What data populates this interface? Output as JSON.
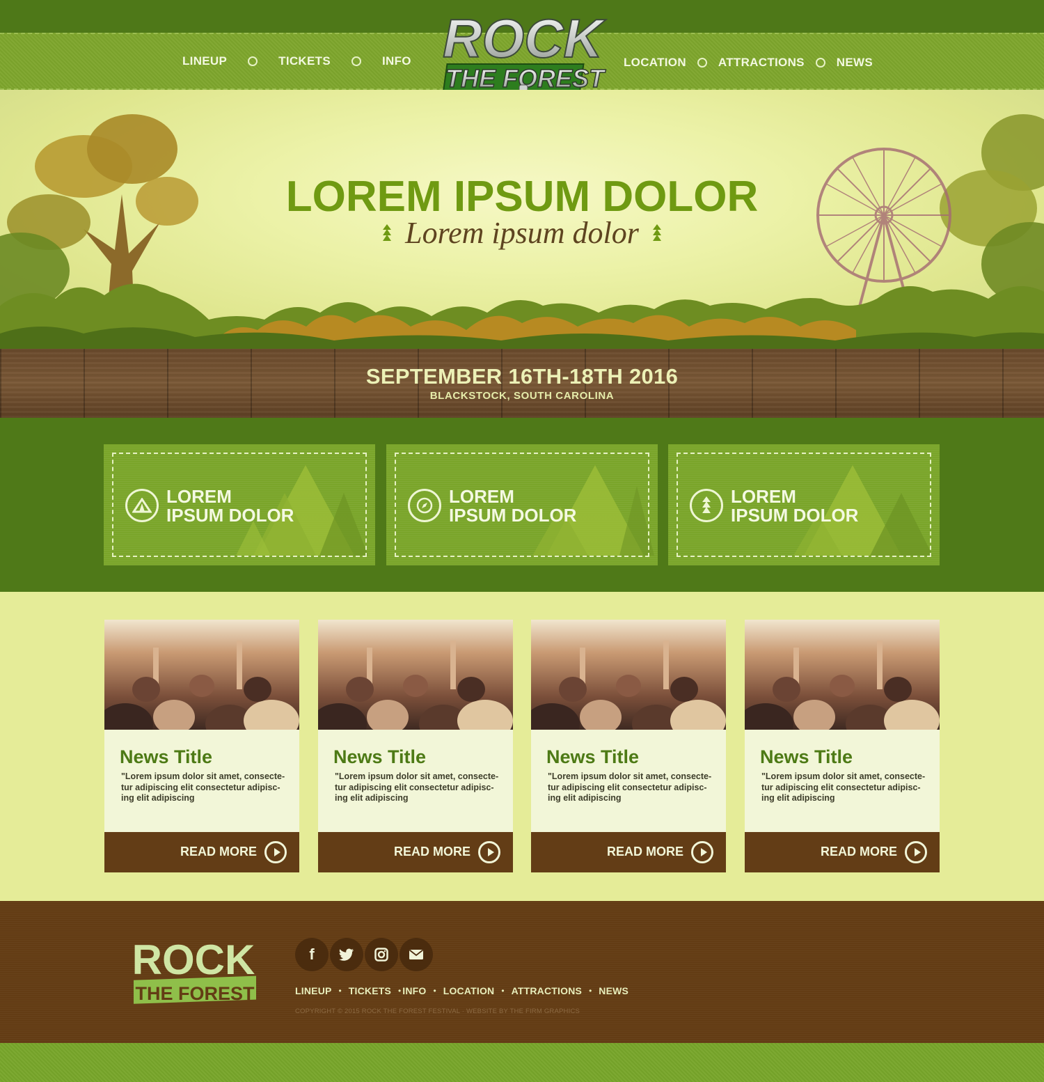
{
  "nav": {
    "left": [
      "LINEUP",
      "TICKETS",
      "INFO"
    ],
    "right": [
      "LOCATION",
      "ATTRACTIONS",
      "NEWS"
    ]
  },
  "logo": {
    "line1": "ROCK",
    "line2": "THE FOREST"
  },
  "hero": {
    "title": "LOREM IPSUM DOLOR",
    "subtitle": "Lorem ipsum dolor"
  },
  "event": {
    "date": "SEPTEMBER 16TH-18TH 2016",
    "location": "BLACKSTOCK, SOUTH CAROLINA"
  },
  "features": [
    {
      "icon": "tent-icon",
      "line1": "LOREM",
      "line2": "IPSUM DOLOR"
    },
    {
      "icon": "compass-icon",
      "line1": "LOREM",
      "line2": "IPSUM DOLOR"
    },
    {
      "icon": "pine-tree-icon",
      "line1": "LOREM",
      "line2": "IPSUM DOLOR"
    }
  ],
  "news": [
    {
      "title": "News Title",
      "text": "\"Lorem ipsum dolor sit amet, consecte-tur adipiscing elit consectetur adipisc-ing elit adipiscing",
      "button": "READ MORE"
    },
    {
      "title": "News Title",
      "text": "\"Lorem ipsum dolor sit amet, consecte-tur adipiscing elit consectetur adipisc-ing elit adipiscing",
      "button": "READ MORE"
    },
    {
      "title": "News Title",
      "text": "\"Lorem ipsum dolor sit amet, consecte-tur adipiscing elit consectetur adipisc-ing elit adipiscing",
      "button": "READ MORE"
    },
    {
      "title": "News Title",
      "text": "\"Lorem ipsum dolor sit amet, consecte-tur adipiscing elit consectetur adipisc-ing elit adipiscing",
      "button": "READ MORE"
    }
  ],
  "footer": {
    "socials": [
      "facebook-icon",
      "twitter-icon",
      "instagram-icon",
      "email-icon"
    ],
    "links": [
      "LINEUP",
      "TICKETS",
      "INFO",
      "LOCATION",
      "ATTRACTIONS",
      "NEWS"
    ],
    "copyright": "COPYRIGHT © 2015 ROCK THE FOREST FESTIVAL · WEBSITE BY THE FIRM GRAPHICS"
  },
  "colors": {
    "nav_green": "#7ea62c",
    "dark_green": "#4f7918",
    "hero_title": "#6f9a12",
    "wood_brown": "#6a4a2c",
    "card_brown": "#633d16",
    "page_cream": "#e5ec98"
  }
}
